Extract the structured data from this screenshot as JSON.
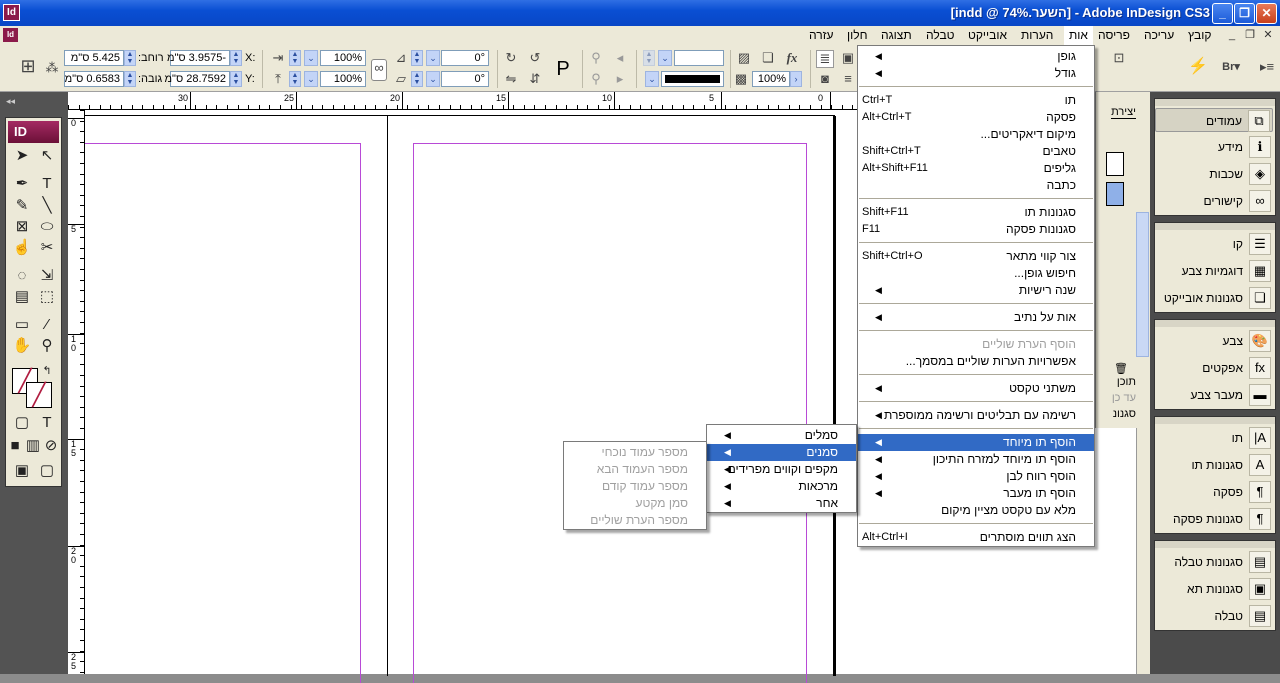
{
  "window": {
    "title": "[indd @ 74%.השער] - Adobe InDesign CS3",
    "app_icon": "Id",
    "minimize": "_",
    "maximize": "❐",
    "close": "✕"
  },
  "menubar": {
    "items": [
      "קובץ",
      "עריכה",
      "פריסה",
      "אות",
      "הערות",
      "אובייקט",
      "טבלה",
      "תצוגה",
      "חלון",
      "עזרה"
    ],
    "open_item": "אות",
    "doc_buttons": [
      "✕",
      "❐",
      "_"
    ]
  },
  "control": {
    "width_label": "רוחב:",
    "width_value": "5.425 ס\"מ",
    "height_label": "גובה:",
    "height_value": "0.6583 ס\"מ",
    "x_label": "X:",
    "x_value": "-3.9575 ס\"מ",
    "y_label": "Y:",
    "y_value": "28.7592 ס\"מ",
    "scale_x": "100%",
    "scale_y": "100%",
    "rotate": "0°",
    "shear": "0°",
    "opacity": "100%",
    "stroke_color": "#000000"
  },
  "rulers": {
    "top_labels": [
      "30",
      "25",
      "20",
      "15",
      "10",
      "5",
      "0"
    ],
    "left_labels": [
      "0",
      "5",
      "10",
      "15",
      "20",
      "25"
    ]
  },
  "type_menu": {
    "items": [
      {
        "label": "גופן",
        "submenu": true
      },
      {
        "label": "גודל",
        "submenu": true
      },
      {
        "sep": true
      },
      {
        "label": "תו",
        "shortcut": "Ctrl+T"
      },
      {
        "label": "פסקה",
        "shortcut": "Alt+Ctrl+T"
      },
      {
        "label": "מיקום דיאקריטים..."
      },
      {
        "label": "טאבים",
        "shortcut": "Shift+Ctrl+T"
      },
      {
        "label": "גליפים",
        "shortcut": "Alt+Shift+F11"
      },
      {
        "label": "כתבה"
      },
      {
        "sep": true
      },
      {
        "label": "סגנונות תו",
        "shortcut": "Shift+F11"
      },
      {
        "label": "סגנונות פסקה",
        "shortcut": "F11"
      },
      {
        "sep": true
      },
      {
        "label": "צור קווי מתאר",
        "shortcut": "Shift+Ctrl+O"
      },
      {
        "label": "חיפוש גופן..."
      },
      {
        "label": "שנה רישיות",
        "submenu": true
      },
      {
        "sep": true
      },
      {
        "label": "אות על נתיב",
        "submenu": true
      },
      {
        "sep": true
      },
      {
        "label": "הוסף הערת שוליים",
        "disabled": true
      },
      {
        "label": "אפשרויות הערות שוליים במסמך..."
      },
      {
        "sep": true
      },
      {
        "label": "משתני טקסט",
        "submenu": true
      },
      {
        "sep": true
      },
      {
        "label": "רשימה עם תבליטים ורשימה ממוספרת",
        "submenu": true
      },
      {
        "sep": true
      },
      {
        "label": "הוסף תו מיוחד",
        "submenu": true,
        "highlighted": true
      },
      {
        "label": "הוסף תו מיוחד למזרח התיכון",
        "submenu": true
      },
      {
        "label": "הוסף רווח לבן",
        "submenu": true
      },
      {
        "label": "הוסף תו מעבר",
        "submenu": true
      },
      {
        "label": "מלא עם טקסט מציין מיקום"
      },
      {
        "sep": true
      },
      {
        "label": "הצג תווים מוסתרים",
        "shortcut": "Alt+Ctrl+I"
      }
    ]
  },
  "special_char_menu": {
    "items": [
      {
        "label": "סמלים",
        "submenu": true
      },
      {
        "label": "סמנים",
        "submenu": true,
        "highlighted": true
      },
      {
        "label": "מקפים וקווים מפרידים",
        "submenu": true
      },
      {
        "label": "מרכאות",
        "submenu": true
      },
      {
        "label": "אחר",
        "submenu": true
      }
    ]
  },
  "markers_menu": {
    "items": [
      {
        "label": "מספר עמוד נוכחי",
        "disabled": true
      },
      {
        "label": "מספר העמוד הבא",
        "disabled": true
      },
      {
        "label": "מספר עמוד קודם",
        "disabled": true
      },
      {
        "label": "סמן מקטע",
        "disabled": true
      },
      {
        "label": "מספר הערת שוליים",
        "disabled": true
      }
    ]
  },
  "partial_panel": {
    "text1": "יצירת",
    "text2": "תוכן",
    "text3": "עד כן",
    "text4": "סגנונ"
  },
  "right_dock": {
    "groups": [
      [
        {
          "label": "עמודים",
          "icon": "pages-icon",
          "glyph": "⧉",
          "active": true
        },
        {
          "label": "מידע",
          "icon": "info-icon",
          "glyph": "ℹ"
        },
        {
          "label": "שכבות",
          "icon": "layers-icon",
          "glyph": "◈"
        },
        {
          "label": "קישורים",
          "icon": "links-icon",
          "glyph": "∞"
        }
      ],
      [
        {
          "label": "קו",
          "icon": "stroke-icon",
          "glyph": "☰"
        },
        {
          "label": "דוגמיות צבע",
          "icon": "swatches-icon",
          "glyph": "▦"
        },
        {
          "label": "סגנונות אובייקט",
          "icon": "object-styles-icon",
          "glyph": "❏"
        }
      ],
      [
        {
          "label": "צבע",
          "icon": "color-icon",
          "glyph": "🎨"
        },
        {
          "label": "אפקטים",
          "icon": "effects-icon",
          "glyph": "fx"
        },
        {
          "label": "מעבר צבע",
          "icon": "gradient-icon",
          "glyph": "▬"
        }
      ],
      [
        {
          "label": "תו",
          "icon": "character-icon",
          "glyph": "A|"
        },
        {
          "label": "סגנונות תו",
          "icon": "character-styles-icon",
          "glyph": "A"
        },
        {
          "label": "פסקה",
          "icon": "paragraph-icon",
          "glyph": "¶"
        },
        {
          "label": "סגנונות פסקה",
          "icon": "paragraph-styles-icon",
          "glyph": "¶"
        }
      ],
      [
        {
          "label": "סגנונות טבלה",
          "icon": "table-styles-icon",
          "glyph": "▤"
        },
        {
          "label": "סגנונות תא",
          "icon": "cell-styles-icon",
          "glyph": "▣"
        },
        {
          "label": "טבלה",
          "icon": "table-icon",
          "glyph": "▤"
        }
      ]
    ]
  },
  "colors": {
    "title_bar": "#0a4fd3",
    "menu_highlight": "#316ac5",
    "margin_guide": "#b84ad6",
    "app_brand": "#8b1a4a"
  }
}
